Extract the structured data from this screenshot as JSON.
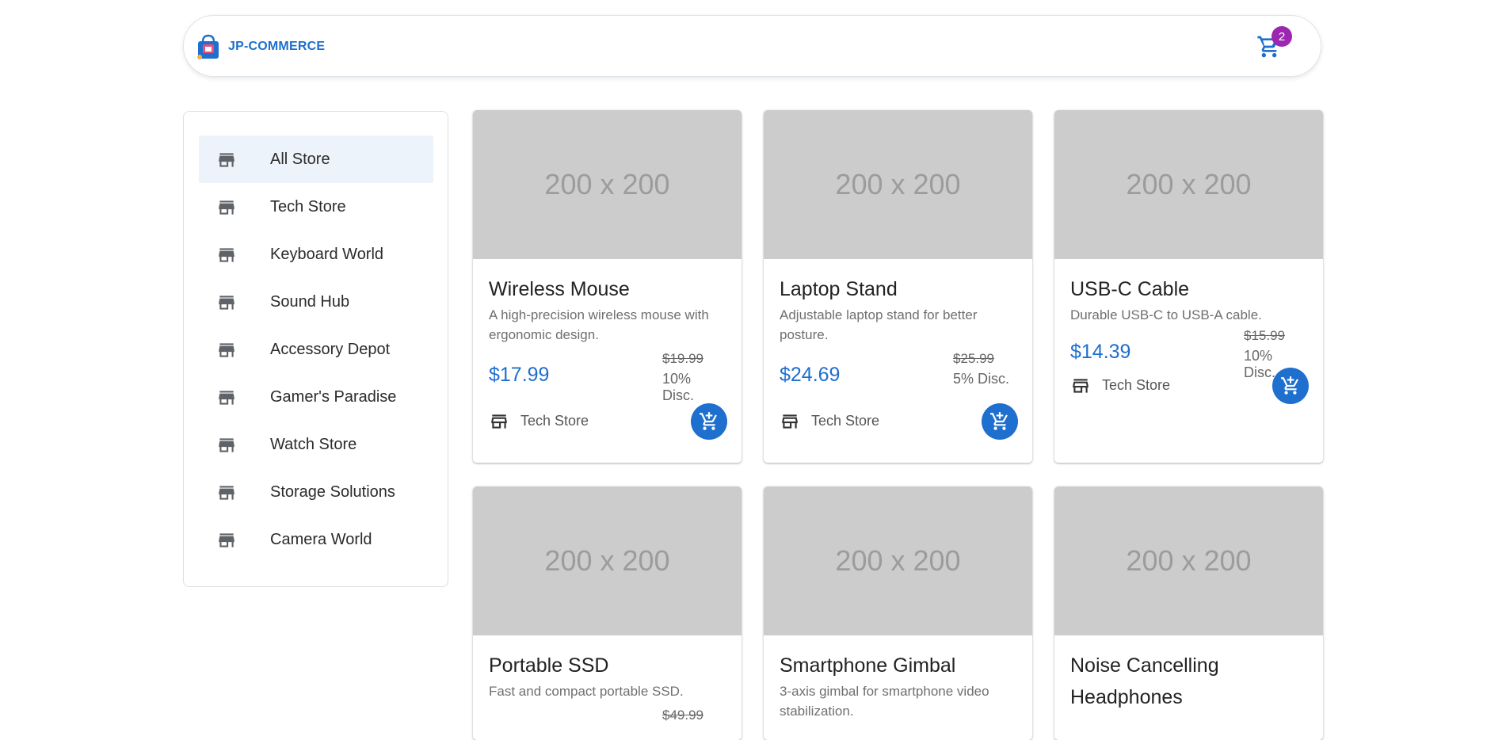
{
  "header": {
    "brand": "JP-COMMERCE",
    "cart_count": "2"
  },
  "sidebar": {
    "items": [
      {
        "label": "All Store",
        "selected": true
      },
      {
        "label": "Tech Store"
      },
      {
        "label": "Keyboard World"
      },
      {
        "label": "Sound Hub"
      },
      {
        "label": "Accessory Depot"
      },
      {
        "label": "Gamer's Paradise"
      },
      {
        "label": "Watch Store"
      },
      {
        "label": "Storage Solutions"
      },
      {
        "label": "Camera World"
      }
    ]
  },
  "products": [
    {
      "image": "200 x 200",
      "title": "Wireless Mouse",
      "desc": "A high-precision wireless mouse with ergonomic design.",
      "price": "$17.99",
      "old_price": "$19.99",
      "discount": "10% Disc.",
      "store": "Tech Store"
    },
    {
      "image": "200 x 200",
      "title": "Laptop Stand",
      "desc": "Adjustable laptop stand for better posture.",
      "price": "$24.69",
      "old_price": "$25.99",
      "discount": "5% Disc.",
      "store": "Tech Store"
    },
    {
      "image": "200 x 200",
      "title": "USB-C Cable",
      "desc": "Durable USB-C to USB-A cable.",
      "price": "$14.39",
      "old_price": "$15.99",
      "discount": "10% Disc.",
      "store": "Tech Store"
    },
    {
      "image": "200 x 200",
      "title": "Portable SSD",
      "desc": "Fast and compact portable SSD.",
      "price": "",
      "old_price": "$49.99",
      "discount": "",
      "store": ""
    },
    {
      "image": "200 x 200",
      "title": "Smartphone Gimbal",
      "desc": "3-axis gimbal for smartphone video stabilization.",
      "price": "",
      "old_price": "",
      "discount": "",
      "store": ""
    },
    {
      "image": "200 x 200",
      "title": "Noise Cancelling Headphones",
      "desc": "",
      "price": "",
      "old_price": "",
      "discount": "",
      "store": ""
    }
  ],
  "colors": {
    "accent": "#1e6fce",
    "badge": "#9c27b0",
    "selected_bg": "#edf3fb",
    "placeholder_bg": "#cccccc"
  },
  "icons": {
    "brand": "shopping-bag-icon",
    "cart": "shopping-cart-icon",
    "store": "storefront-icon",
    "add_to_cart": "add-shopping-cart-icon"
  }
}
